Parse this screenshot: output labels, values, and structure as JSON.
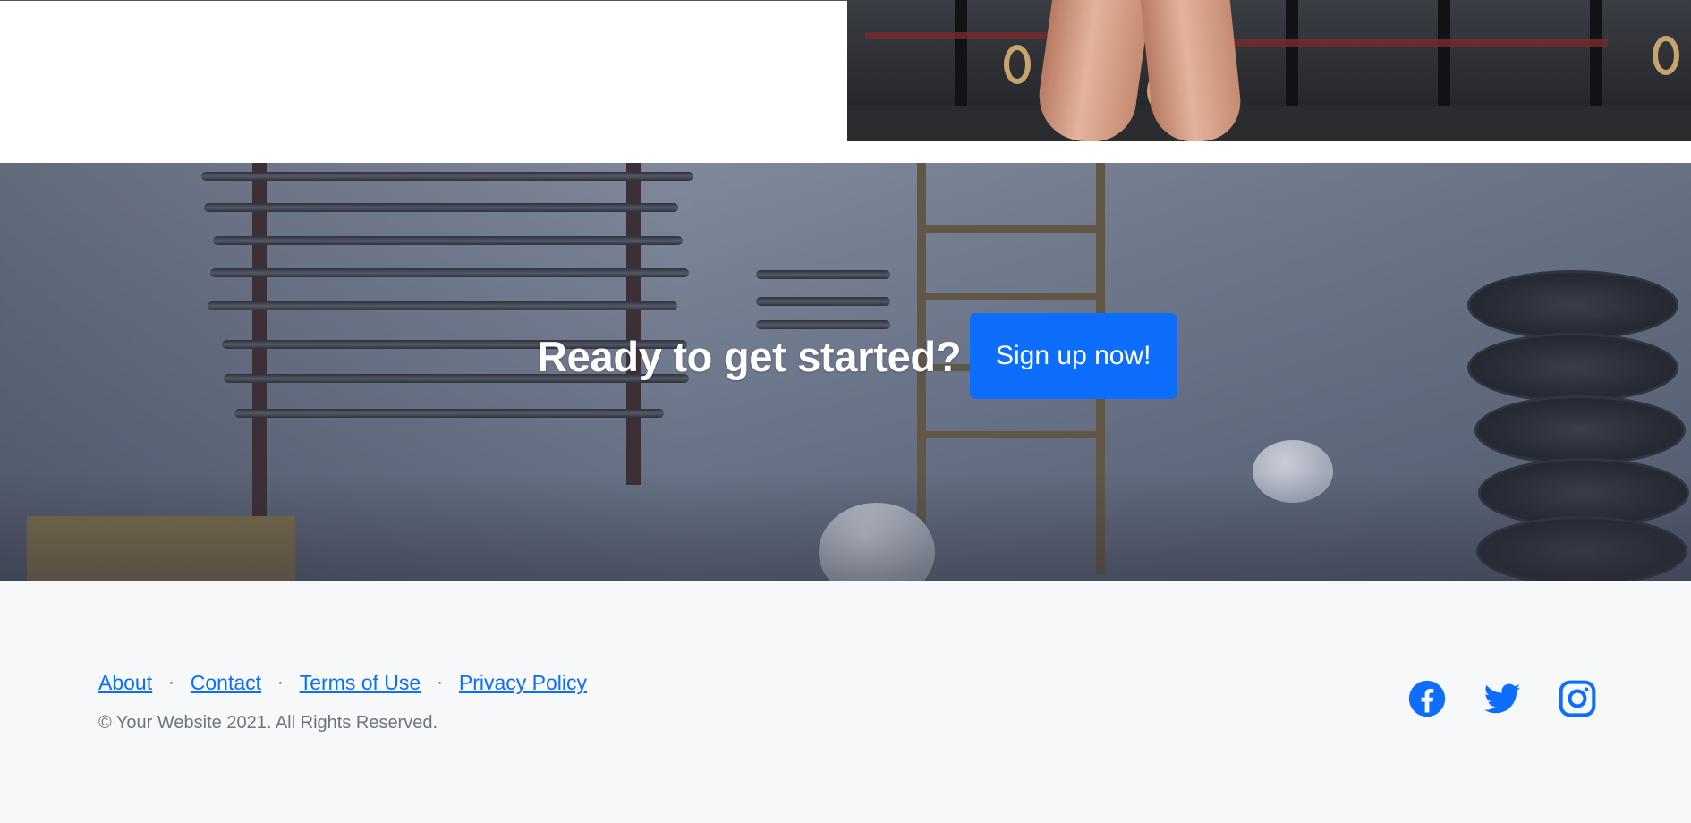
{
  "cta": {
    "heading": "Ready to get started?",
    "button_label": "Sign up now!"
  },
  "footer": {
    "links": [
      {
        "label": "About"
      },
      {
        "label": "Contact"
      },
      {
        "label": "Terms of Use"
      },
      {
        "label": "Privacy Policy"
      }
    ],
    "separator": "·",
    "copyright": "© Your Website 2021. All Rights Reserved.",
    "social": [
      {
        "icon": "facebook-icon"
      },
      {
        "icon": "twitter-icon"
      },
      {
        "icon": "instagram-icon"
      }
    ]
  },
  "colors": {
    "primary": "#0d6efd",
    "footer_bg": "#f7f8fa",
    "muted_text": "#6c757d"
  }
}
